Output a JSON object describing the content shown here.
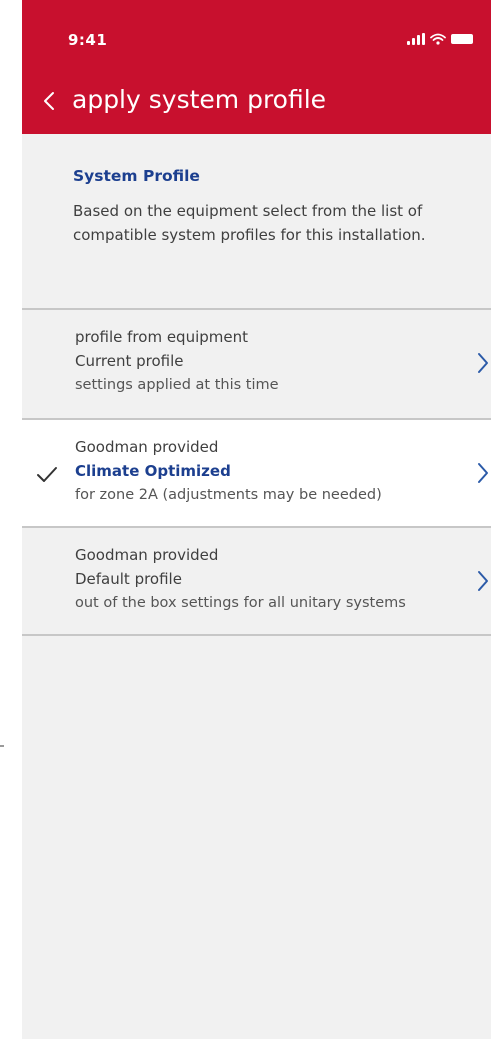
{
  "status_bar": {
    "time": "9:41"
  },
  "header": {
    "title": "apply system profile",
    "background_color": "#c8102e"
  },
  "intro": {
    "title": "System  Profile",
    "description": "Based on the equipment select from the list of compatible system profiles for this installation."
  },
  "profiles": [
    {
      "source": "profile from equipment",
      "name": "Current profile",
      "note": "settings applied at this time",
      "selected": false
    },
    {
      "source": "Goodman provided",
      "name": "Climate Optimized",
      "note": "for zone 2A (adjustments may be needed)",
      "selected": true
    },
    {
      "source": "Goodman provided",
      "name": "Default profile",
      "note": "out of the box settings for all unitary systems",
      "selected": false
    }
  ],
  "icons": {
    "back": "chevron-left-icon",
    "row_arrow": "chevron-right-icon",
    "selected": "checkmark-icon",
    "signal": "cellular-signal-icon",
    "wifi": "wifi-icon",
    "battery": "battery-icon"
  },
  "colors": {
    "accent_blue": "#1c3f8f",
    "chevron_blue": "#2b5aa8",
    "background": "#f1f1f1"
  }
}
